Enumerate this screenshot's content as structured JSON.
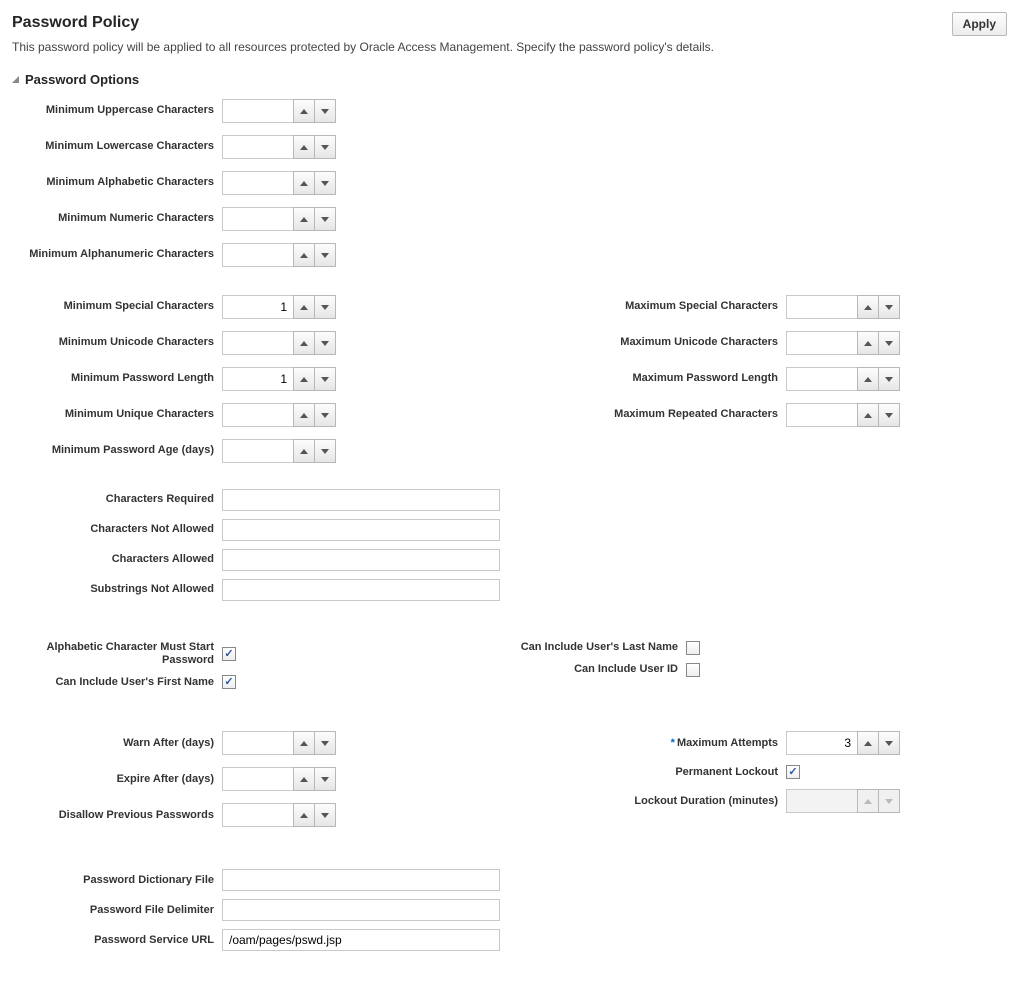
{
  "page": {
    "title": "Password Policy",
    "apply_label": "Apply",
    "description": "This password policy will be applied to all resources protected by Oracle Access Management. Specify the password policy's details."
  },
  "section": {
    "password_options": "Password Options"
  },
  "labels": {
    "min_uppercase": "Minimum Uppercase Characters",
    "min_lowercase": "Minimum Lowercase Characters",
    "min_alpha": "Minimum Alphabetic Characters",
    "min_numeric": "Minimum Numeric Characters",
    "min_alnum": "Minimum Alphanumeric Characters",
    "min_special": "Minimum Special Characters",
    "min_unicode": "Minimum Unicode Characters",
    "min_length": "Minimum Password Length",
    "min_unique": "Minimum Unique Characters",
    "min_age": "Minimum Password Age (days)",
    "max_special": "Maximum Special Characters",
    "max_unicode": "Maximum Unicode Characters",
    "max_length": "Maximum Password Length",
    "max_repeated": "Maximum Repeated Characters",
    "chars_required": "Characters Required",
    "chars_not_allowed": "Characters Not Allowed",
    "chars_allowed": "Characters Allowed",
    "substrings_not_allowed": "Substrings Not Allowed",
    "alpha_must_start": "Alphabetic Character Must Start Password",
    "can_include_first_name": "Can Include User's First Name",
    "can_include_last_name": "Can Include User's Last Name",
    "can_include_user_id": "Can Include User ID",
    "warn_after": "Warn After (days)",
    "expire_after": "Expire After (days)",
    "disallow_previous": "Disallow Previous Passwords",
    "max_attempts": "Maximum Attempts",
    "permanent_lockout": "Permanent Lockout",
    "lockout_duration": "Lockout Duration (minutes)",
    "dictionary_file": "Password Dictionary File",
    "file_delimiter": "Password File Delimiter",
    "service_url": "Password Service URL"
  },
  "values": {
    "min_uppercase": "",
    "min_lowercase": "",
    "min_alpha": "",
    "min_numeric": "",
    "min_alnum": "",
    "min_special": "1",
    "min_unicode": "",
    "min_length": "1",
    "min_unique": "",
    "min_age": "",
    "max_special": "",
    "max_unicode": "",
    "max_length": "",
    "max_repeated": "",
    "chars_required": "",
    "chars_not_allowed": "",
    "chars_allowed": "",
    "substrings_not_allowed": "",
    "alpha_must_start_checked": true,
    "can_include_first_name_checked": true,
    "can_include_last_name_checked": false,
    "can_include_user_id_checked": false,
    "warn_after": "",
    "expire_after": "",
    "disallow_previous": "",
    "max_attempts": "3",
    "permanent_lockout_checked": true,
    "lockout_duration": "",
    "lockout_duration_disabled": true,
    "dictionary_file": "",
    "file_delimiter": "",
    "service_url": "/oam/pages/pswd.jsp"
  }
}
